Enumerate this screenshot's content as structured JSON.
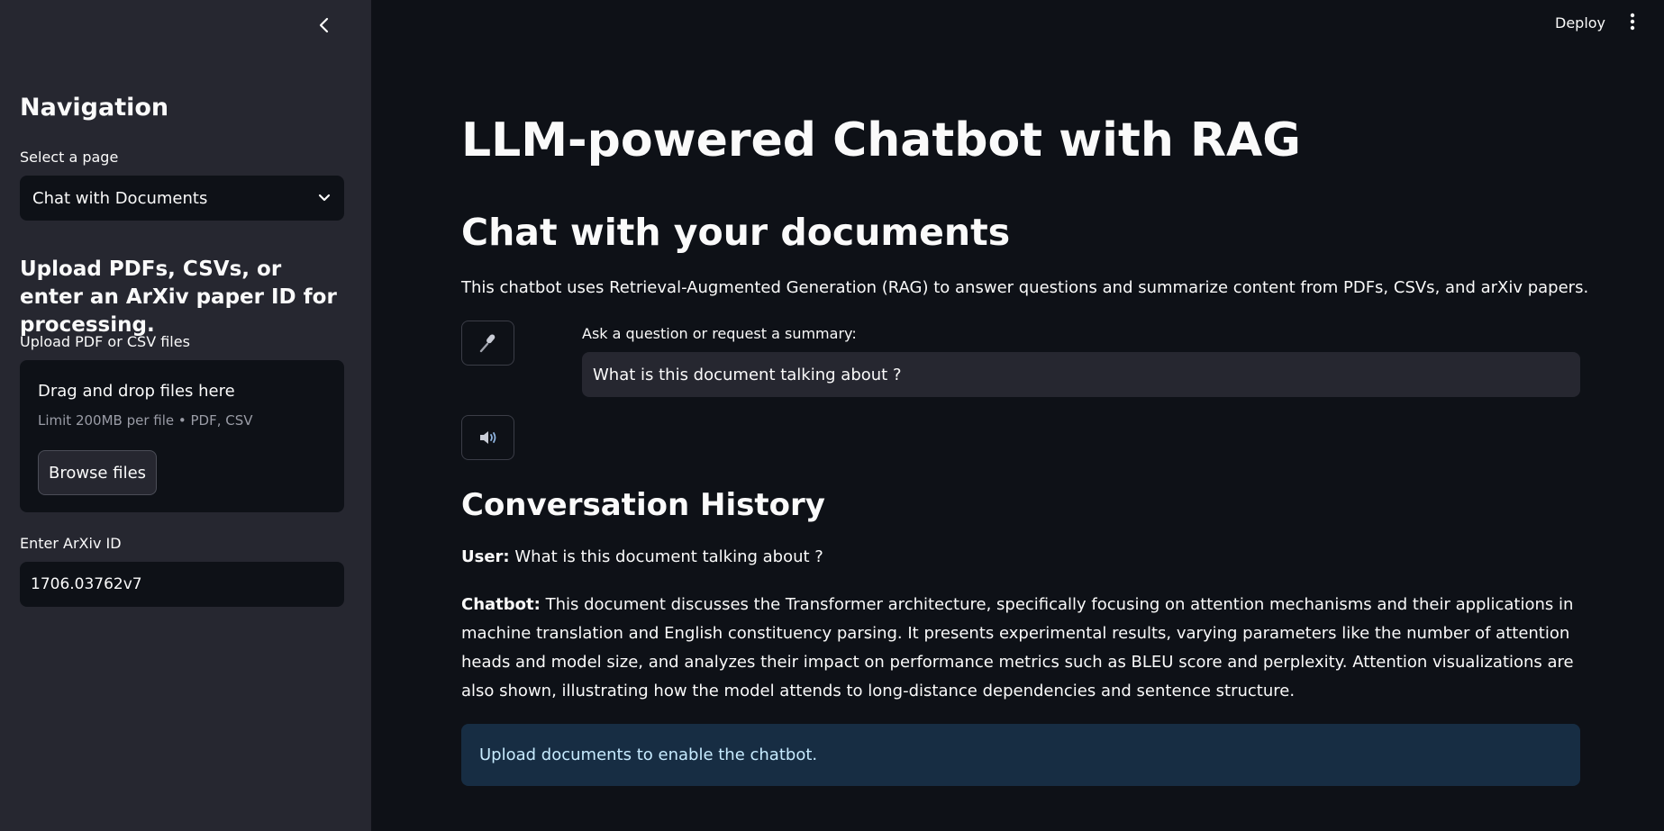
{
  "topbar": {
    "deploy_label": "Deploy"
  },
  "sidebar": {
    "nav_title": "Navigation",
    "select_label": "Select a page",
    "select_value": "Chat with Documents",
    "upload_heading": "Upload PDFs, CSVs, or enter an ArXiv paper ID for processing.",
    "upload_label": "Upload PDF or CSV files",
    "dropzone_title": "Drag and drop files here",
    "dropzone_limit": "Limit 200MB per file • PDF, CSV",
    "browse_label": "Browse files",
    "arxiv_label": "Enter ArXiv ID",
    "arxiv_value": "1706.03762v7"
  },
  "main": {
    "title": "LLM-powered Chatbot with RAG",
    "subtitle": "Chat with your documents",
    "description": "This chatbot uses Retrieval-Augmented Generation (RAG) to answer questions and summarize content from PDFs, CSVs, and arXiv papers.",
    "ask_label": "Ask a question or request a summary:",
    "ask_value": "What is this document talking about ?",
    "history_title": "Conversation History",
    "messages": [
      {
        "speaker": "User:",
        "text": "What is this document talking about ?"
      },
      {
        "speaker": "Chatbot:",
        "text": "This document discusses the Transformer architecture, specifically focusing on attention mechanisms and their applications in machine translation and English constituency parsing. It presents experimental results, varying parameters like the number of attention heads and model size, and analyzes their impact on performance metrics such as BLEU score and perplexity. Attention visualizations are also shown, illustrating how the model attends to long-distance dependencies and sentence structure."
      }
    ],
    "info_message": "Upload documents to enable the chatbot."
  },
  "icons": {
    "mic": "microphone-icon",
    "speaker": "speaker-icon",
    "collapse": "chevron-left-icon",
    "dropdown": "chevron-down-icon",
    "menu": "kebab-menu-icon"
  },
  "colors": {
    "background": "#0e1117",
    "sidebar": "#262730",
    "info_bg": "#172d43",
    "info_text": "#c7ebff"
  }
}
